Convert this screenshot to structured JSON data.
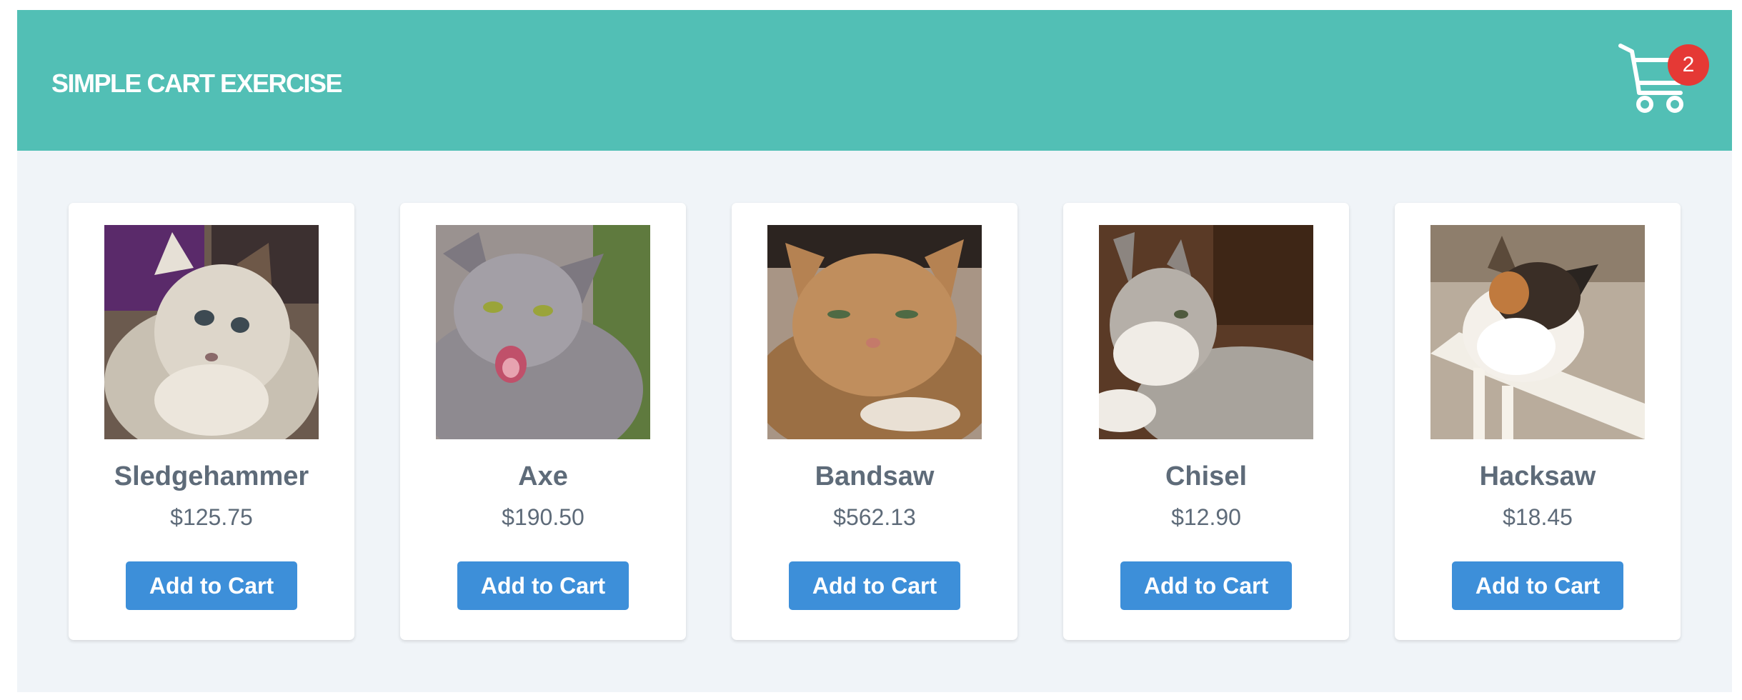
{
  "header": {
    "title": "SIMPLE CART EXERCISE",
    "cart_icon": "shopping-cart-icon",
    "cart_count": "2",
    "accent_color": "#52bfb5",
    "badge_color": "#e53935"
  },
  "button_color": "#3d8fd9",
  "products": [
    {
      "name": "Sledgehammer",
      "price": "$125.75",
      "button": "Add to Cart",
      "image": "cat-photo-fluffy-ragdoll"
    },
    {
      "name": "Axe",
      "price": "$190.50",
      "button": "Add to Cart",
      "image": "cat-photo-grey-hissing"
    },
    {
      "name": "Bandsaw",
      "price": "$562.13",
      "button": "Add to Cart",
      "image": "cat-photo-orange-tabby"
    },
    {
      "name": "Chisel",
      "price": "$12.90",
      "button": "Add to Cart",
      "image": "cat-photo-grey-tabby-white"
    },
    {
      "name": "Hacksaw",
      "price": "$18.45",
      "button": "Add to Cart",
      "image": "cat-photo-calico"
    }
  ]
}
